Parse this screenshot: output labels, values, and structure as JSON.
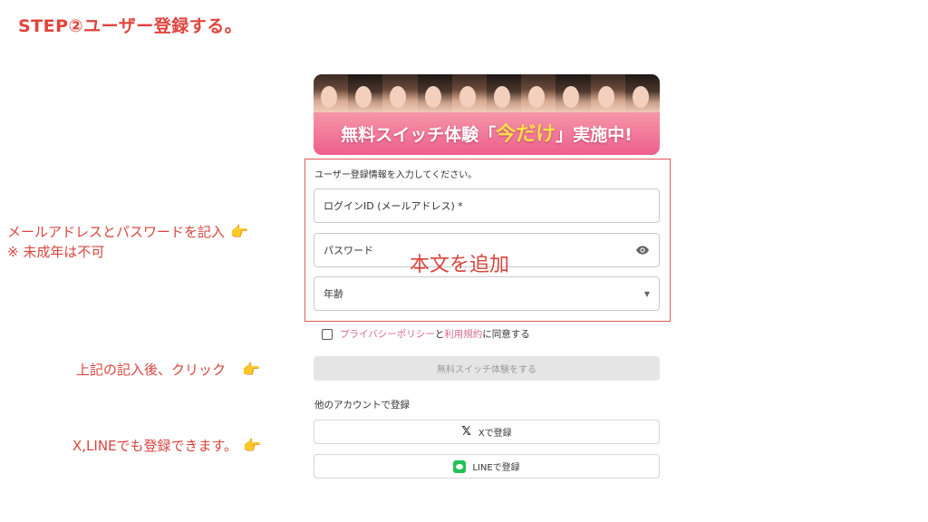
{
  "step_title": "STEP②ユーザー登録する。",
  "banner": {
    "text_before": "無料スイッチ体験「",
    "text_highlight": "今だけ",
    "text_after": "」実施中!"
  },
  "annotations": {
    "note1_line1": "メールアドレスとパスワードを記入",
    "note1_line2": "※ 未成年は不可",
    "note2": "上記の記入後、クリック",
    "note3": "X,LINEでも登録できます。",
    "hand_glyph": "👉",
    "overlay": "本文を追加"
  },
  "form": {
    "caption": "ユーザー登録情報を入力してください。",
    "login_placeholder": "ログインID (メールアドレス) *",
    "password_placeholder": "パスワード",
    "age_placeholder": "年齢"
  },
  "consent": {
    "privacy_link": "プライバシーポリシー",
    "and": "と",
    "terms_link": "利用規約",
    "suffix": "に同意する"
  },
  "submit_label": "無料スイッチ体験をする",
  "other_accounts_label": "他のアカウントで登録",
  "social": {
    "x_label": "Xで登録",
    "line_label": "LINEで登録"
  },
  "colors": {
    "accent_red": "#e0443c",
    "link_pink": "#d76a8f",
    "line_green": "#22c155"
  }
}
